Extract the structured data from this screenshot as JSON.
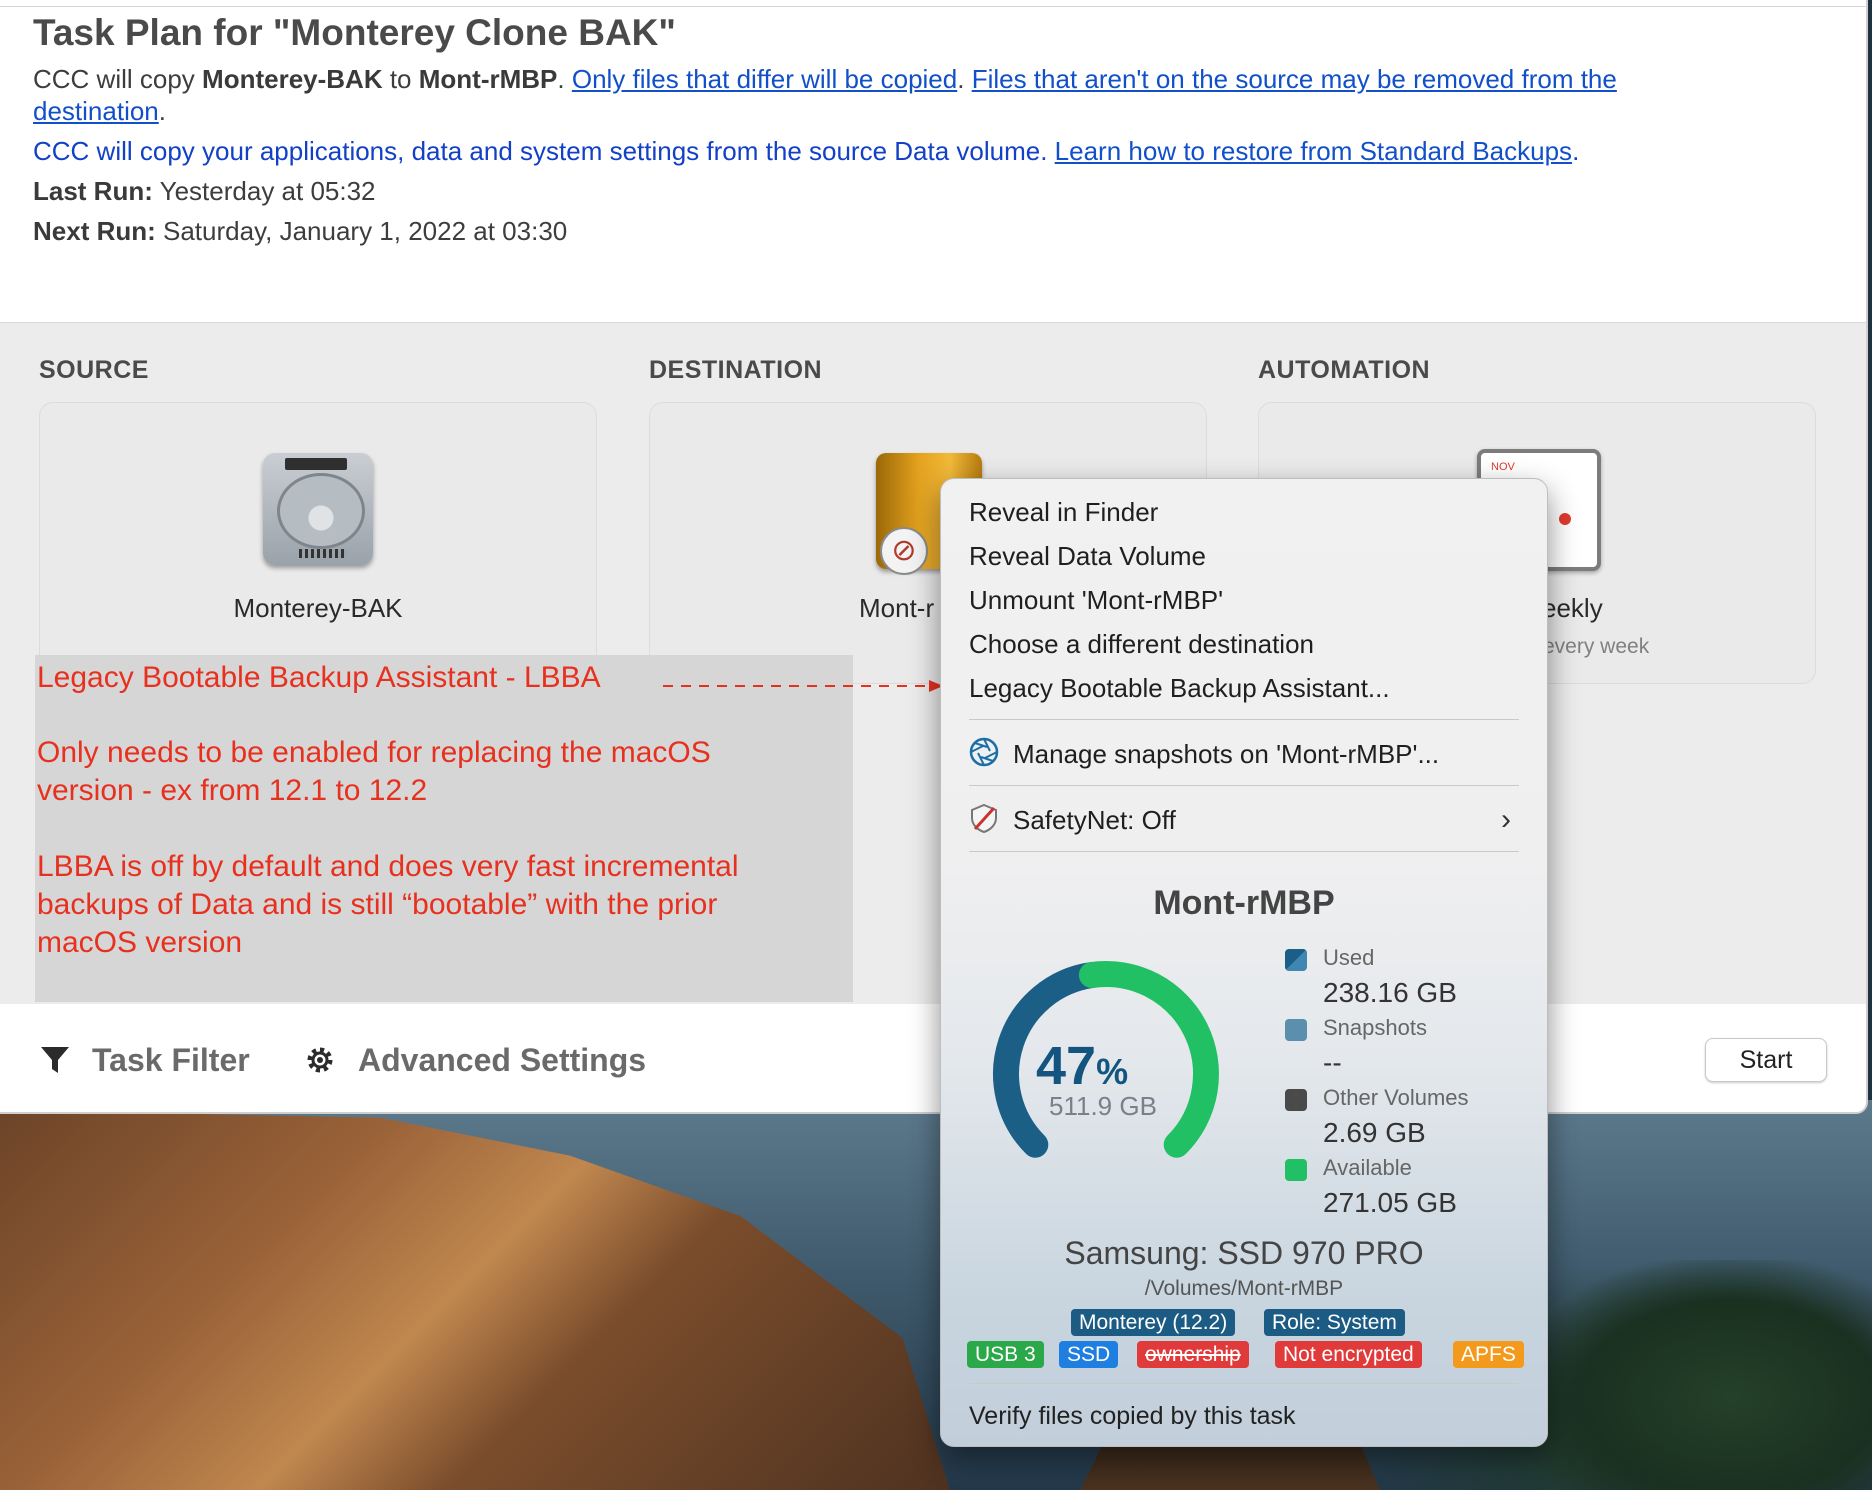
{
  "header": {
    "title": "Task Plan for \"Monterey Clone BAK\"",
    "line1": {
      "prefix": "CCC will copy ",
      "source": "Monterey-BAK",
      "mid": " to ",
      "dest": "Mont-rMBP",
      "dot": ". ",
      "link1": "Only files that differ will be copied",
      "dot2": ". ",
      "link2a": "Files that aren't on the source may be removed from the",
      "link2b": "destination",
      "end": "."
    },
    "line2": {
      "text": "CCC will copy your applications, data and system settings from the source Data volume. ",
      "link": "Learn how to restore from Standard Backups",
      "end": "."
    },
    "last_run_label": "Last Run:",
    "last_run_value": " Yesterday at 05:32",
    "next_run_label": "Next Run:",
    "next_run_value": " Saturday, January 1, 2022 at 03:30"
  },
  "sections": {
    "source_label": "SOURCE",
    "destination_label": "DESTINATION",
    "automation_label": "AUTOMATION"
  },
  "cards": {
    "source_name": "Monterey-BAK",
    "destination_name": "Mont-r",
    "automation_name": "eekly",
    "automation_sub": "every week",
    "calendar_month": "NOV"
  },
  "annotation": {
    "p1": "Legacy Bootable Backup Assistant - LBBA",
    "p2a": "Only needs to be enabled for replacing the macOS",
    "p2b": "version - ex from 12.1 to 12.2",
    "p3a": "LBBA is off by default and does very fast incremental",
    "p3b": "backups of Data and is still “bootable” with the prior",
    "p3c": "macOS version"
  },
  "toolbar": {
    "task_filter": "Task Filter",
    "advanced_settings": "Advanced Settings",
    "start": "Start"
  },
  "menu": {
    "items": [
      "Reveal in Finder",
      "Reveal Data Volume",
      "Unmount 'Mont-rMBP'",
      "Choose a different destination",
      "Legacy Bootable Backup Assistant..."
    ],
    "manage_snapshots": "Manage snapshots on 'Mont-rMBP'...",
    "safetynet": "SafetyNet: Off",
    "disk_name": "Mont-rMBP",
    "gauge": {
      "percent": "47",
      "percent_sign": "%",
      "capacity": "511.9 GB",
      "used_fraction": 0.47,
      "used_color": "#1b5f86",
      "available_color": "#21c064"
    },
    "legend": [
      {
        "label": "Used",
        "value": "238.16 GB",
        "color": "#1b5f86"
      },
      {
        "label": "Snapshots",
        "value": "--",
        "color": "#5b8fae"
      },
      {
        "label": "Other Volumes",
        "value": "2.69 GB",
        "color": "#4a4a4a"
      },
      {
        "label": "Available",
        "value": "271.05 GB",
        "color": "#21c064"
      }
    ],
    "model": "Samsung: SSD 970 PRO",
    "path": "/Volumes/Mont-rMBP",
    "tags_row1": [
      {
        "text": "Monterey (12.2)",
        "color": "#1c5c84"
      },
      {
        "text": "Role: System",
        "color": "#1c5c84"
      }
    ],
    "tags_row2": [
      {
        "text": "USB 3",
        "color": "#2aa84a"
      },
      {
        "text": "SSD",
        "color": "#1f7fe0"
      },
      {
        "text": "ownership",
        "color": "#e03a3a"
      },
      {
        "text": "Not encrypted",
        "color": "#e03a3a"
      },
      {
        "text": "APFS",
        "color": "#f39a1d"
      }
    ],
    "verify": "Verify files copied by this task"
  }
}
